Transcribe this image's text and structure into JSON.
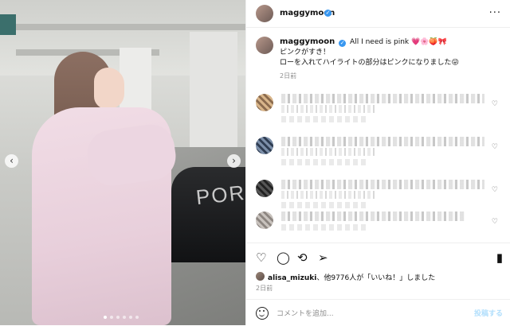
{
  "header": {
    "username": "maggymoon"
  },
  "caption": {
    "username": "maggymoon",
    "line1": "All I need is pink 💗🌸🍑🎀",
    "line2": "ピンクがすき！",
    "line3": "ローを入れてハイライトの部分はピンクになりました😜",
    "age": "2日前"
  },
  "comments": [
    {
      "blurred": true
    },
    {
      "blurred": true
    },
    {
      "blurred": true
    },
    {
      "blurred": true
    }
  ],
  "likes": {
    "first_user": "alisa_mizuki",
    "rest": "、他9776人が「いいね！」しました",
    "age": "2日前"
  },
  "footer": {
    "placeholder": "コメントを追加...",
    "post": "投稿する"
  },
  "icons": {
    "prev": "chevron-left-icon",
    "next": "chevron-right-icon",
    "like": "heart-icon",
    "comment": "comment-icon",
    "share": "share-icon",
    "send": "send-icon",
    "save": "bookmark-icon",
    "emoji": "emoji-icon",
    "more": "more-icon"
  }
}
